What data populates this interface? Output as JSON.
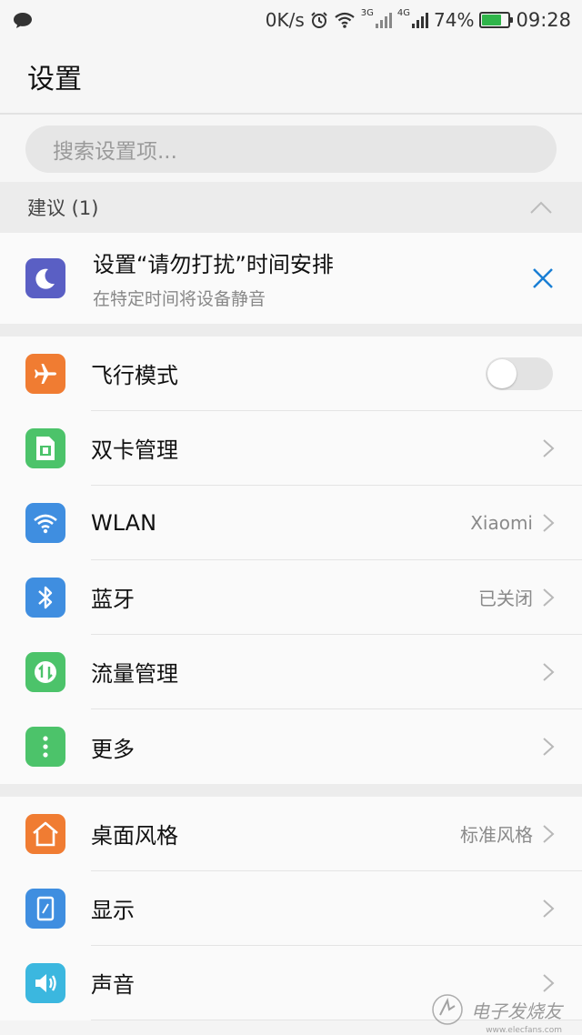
{
  "status_bar": {
    "net_speed": "0K/s",
    "net_3g": "3G",
    "net_4g": "4G",
    "battery_percent": "74%",
    "battery_level": 0.74,
    "time": "09:28",
    "icons": [
      "message-icon",
      "alarm-icon",
      "wifi-icon",
      "signal-icon",
      "battery-icon"
    ]
  },
  "header": {
    "title": "设置"
  },
  "search": {
    "placeholder": "搜索设置项..."
  },
  "suggestions": {
    "header": "建议 (1)",
    "item": {
      "title": "设置“请勿打扰”时间安排",
      "subtitle": "在特定时间将设备静音",
      "icon_color": "#5a5fc4"
    }
  },
  "group1": [
    {
      "label": "飞行模式",
      "value": "",
      "control": "toggle",
      "toggle_on": false,
      "icon": "airplane-icon",
      "color": "#f07c32"
    },
    {
      "label": "双卡管理",
      "value": "",
      "control": "chevron",
      "icon": "sim-card-icon",
      "color": "#4cc36a"
    },
    {
      "label": "WLAN",
      "value": "Xiaomi",
      "control": "chevron",
      "icon": "wifi-icon",
      "color": "#3f8ee0"
    },
    {
      "label": "蓝牙",
      "value": "已关闭",
      "control": "chevron",
      "icon": "bluetooth-icon",
      "color": "#3f8ee0"
    },
    {
      "label": "流量管理",
      "value": "",
      "control": "chevron",
      "icon": "data-usage-icon",
      "color": "#4cc36a"
    },
    {
      "label": "更多",
      "value": "",
      "control": "chevron",
      "icon": "more-icon",
      "color": "#4cc36a"
    }
  ],
  "group2": [
    {
      "label": "桌面风格",
      "value": "标准风格",
      "control": "chevron",
      "icon": "home-icon",
      "color": "#f07c32"
    },
    {
      "label": "显示",
      "value": "",
      "control": "chevron",
      "icon": "display-icon",
      "color": "#3f8ee0"
    },
    {
      "label": "声音",
      "value": "",
      "control": "chevron",
      "icon": "speaker-icon",
      "color": "#3bb7df"
    }
  ],
  "watermark": {
    "text": "电子发烧友",
    "url": "www.elecfans.com"
  },
  "colors": {
    "accent": "#1a7fd4",
    "background": "#f4f4f4"
  }
}
